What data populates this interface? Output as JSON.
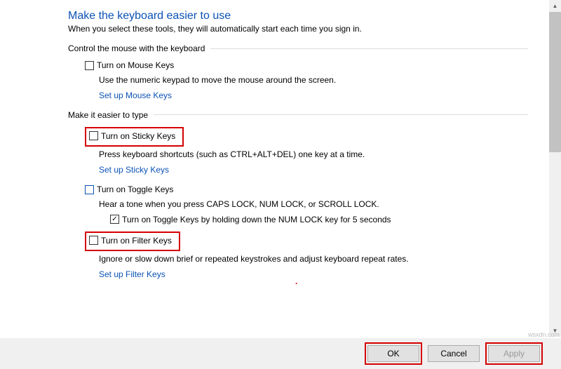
{
  "header": {
    "title": "Make the keyboard easier to use",
    "subtitle": "When you select these tools, they will automatically start each time you sign in."
  },
  "group_mouse": {
    "label": "Control the mouse with the keyboard",
    "mouse_keys": {
      "label": "Turn on Mouse Keys",
      "desc": "Use the numeric keypad to move the mouse around the screen.",
      "link": "Set up Mouse Keys"
    }
  },
  "group_type": {
    "label": "Make it easier to type",
    "sticky": {
      "label": "Turn on Sticky Keys",
      "desc": "Press keyboard shortcuts (such as CTRL+ALT+DEL) one key at a time.",
      "link": "Set up Sticky Keys"
    },
    "toggle": {
      "label": "Turn on Toggle Keys",
      "desc": "Hear a tone when you press CAPS LOCK, NUM LOCK, or SCROLL LOCK.",
      "sub": "Turn on Toggle Keys by holding down the NUM LOCK key for 5 seconds"
    },
    "filter": {
      "label": "Turn on Filter Keys",
      "desc": "Ignore or slow down brief or repeated keystrokes and adjust keyboard repeat rates.",
      "link": "Set up Filter Keys"
    }
  },
  "buttons": {
    "ok": "OK",
    "cancel": "Cancel",
    "apply": "Apply"
  },
  "watermark": "wsxdn.com"
}
